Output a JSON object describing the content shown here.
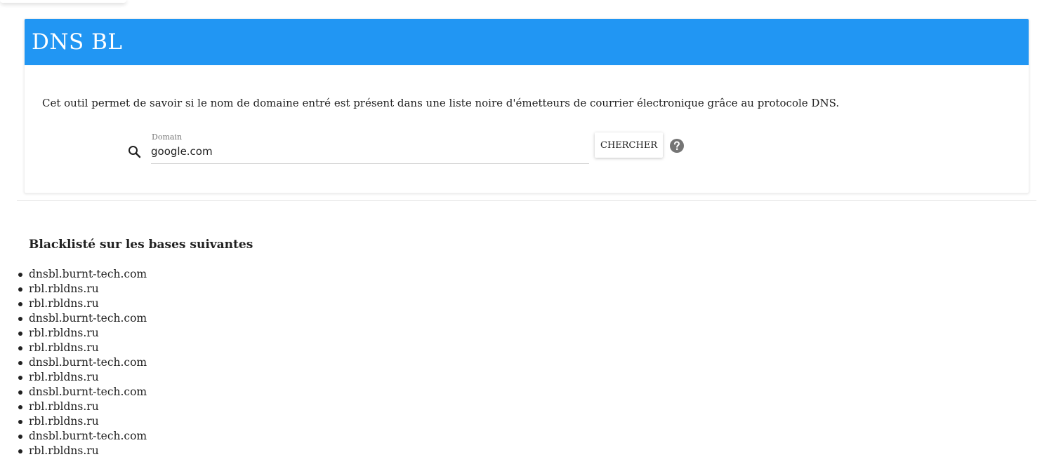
{
  "header": {
    "title": "DNS BL",
    "accent_color": "#2196f3"
  },
  "intro": {
    "description": "Cet outil permet de savoir si le nom de domaine entré est présent dans une liste noire d'émetteurs de courrier électronique grâce au protocole DNS."
  },
  "search": {
    "icon": "search-icon",
    "label": "Domain",
    "value": "google.com",
    "button_label": "CHERCHER",
    "help_icon": "help-icon"
  },
  "results": {
    "heading": "Blacklisté sur les bases suivantes",
    "items": [
      "dnsbl.burnt-tech.com",
      "rbl.rbldns.ru",
      "rbl.rbldns.ru",
      "dnsbl.burnt-tech.com",
      "rbl.rbldns.ru",
      "rbl.rbldns.ru",
      "dnsbl.burnt-tech.com",
      "rbl.rbldns.ru",
      "dnsbl.burnt-tech.com",
      "rbl.rbldns.ru",
      "rbl.rbldns.ru",
      "dnsbl.burnt-tech.com",
      "rbl.rbldns.ru"
    ]
  }
}
